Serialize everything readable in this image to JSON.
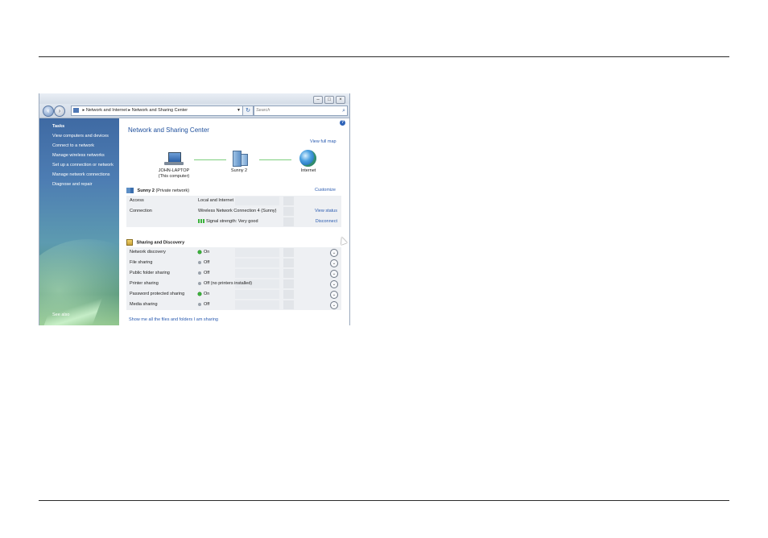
{
  "window": {
    "address": {
      "crumbs": [
        "Network and Internet",
        "Network and Sharing Center"
      ],
      "separator": "▸"
    },
    "search_placeholder": "Search"
  },
  "sidebar": {
    "title": "Tasks",
    "items": [
      "View computers and devices",
      "Connect to a network",
      "Manage wireless networks",
      "Set up a connection or network",
      "Manage network connections",
      "Diagnose and repair"
    ],
    "see_also": "See also"
  },
  "main": {
    "title": "Network and Sharing Center",
    "view_full_map": "View full map",
    "map": {
      "computer_name": "JOHN-LAPTOP",
      "computer_sub": "(This computer)",
      "network_name": "Sunny 2",
      "internet_label": "Internet"
    },
    "network": {
      "name": "Sunny  2",
      "type": "(Private network)",
      "customize": "Customize",
      "rows": [
        {
          "label": "Access",
          "value": "Local and Internet",
          "action": ""
        },
        {
          "label": "Connection",
          "value": "Wireless Network Connection 4 (Sunny)",
          "action": "View status"
        },
        {
          "label": "",
          "value": "Signal strength:  Very good",
          "action": "Disconnect"
        }
      ]
    },
    "sharing": {
      "title": "Sharing and Discovery",
      "rows": [
        {
          "label": "Network discovery",
          "state": "On",
          "on": true
        },
        {
          "label": "File sharing",
          "state": "Off",
          "on": false
        },
        {
          "label": "Public folder sharing",
          "state": "Off",
          "on": false
        },
        {
          "label": "Printer sharing",
          "state": "Off (no printers installed)",
          "on": false
        },
        {
          "label": "Password protected sharing",
          "state": "On",
          "on": true
        },
        {
          "label": "Media sharing",
          "state": "Off",
          "on": false
        }
      ]
    },
    "show_sharing_link": "Show me all the files and folders I am sharing"
  },
  "icons": {
    "back": "back-arrow-icon",
    "forward": "forward-arrow-icon",
    "refresh": "refresh-icon",
    "search": "search-icon",
    "help": "help-icon"
  }
}
